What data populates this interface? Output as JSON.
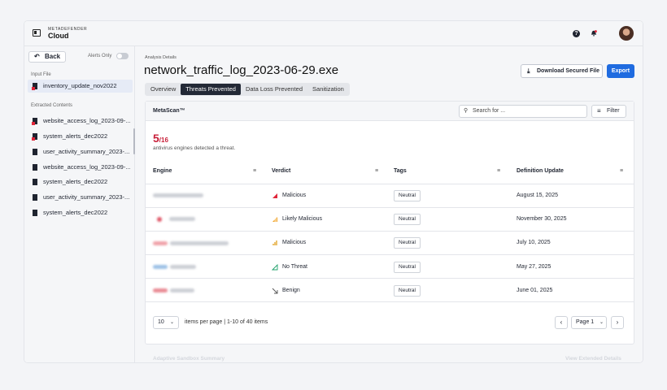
{
  "app": {
    "brand_small": "METADEFENDER",
    "brand_big": "Cloud"
  },
  "header_icons": [
    "help-icon",
    "bell-icon",
    "avatar"
  ],
  "colors": {
    "accent": "#1f6be0",
    "danger": "#c8203a",
    "active_tab": "#232936"
  },
  "sidebar": {
    "back_label": "Back",
    "alerts_only_label": "Alerts Only",
    "alerts_only_on": false,
    "input_file_label": "Input File",
    "input_file": {
      "name": "inventory_update_nov2022",
      "icon": "file-threat-icon"
    },
    "extracted_label": "Extracted Contents",
    "extracted": [
      {
        "name": "website_access_log_2023-09-...",
        "icon": "file-threat-icon"
      },
      {
        "name": "system_alerts_dec2022",
        "icon": "file-threat-icon"
      },
      {
        "name": "user_activity_summary_2023-...",
        "icon": "file-icon"
      },
      {
        "name": "website_access_log_2023-09-...",
        "icon": "file-icon"
      },
      {
        "name": "system_alerts_dec2022",
        "icon": "file-icon"
      },
      {
        "name": "user_activity_summary_2023-...",
        "icon": "file-icon"
      },
      {
        "name": "system_alerts_dec2022",
        "icon": "file-icon"
      }
    ]
  },
  "main": {
    "breadcrumb": "Analysis Details",
    "title": "network_traffic_log_2023-06-29.exe",
    "download_label": "Download Secured File",
    "export_label": "Export",
    "tabs": [
      "Overview",
      "Threats Prevented",
      "Data Loss Prevented",
      "Sanitization"
    ],
    "active_tab": "Threats Prevented"
  },
  "metascan": {
    "title": "MetaScan™",
    "search_placeholder": "Search for ...",
    "filter_label": "Filter",
    "detected": "5",
    "total": "/16",
    "detected_text": "antivirus engines detected a threat.",
    "columns": [
      "Engine",
      "Verdict",
      "Tags",
      "Definition Update"
    ],
    "rows": [
      {
        "verdict": "Malicious",
        "verdict_icon": "malicious-icon",
        "tag": "Neutral",
        "date": "August 15, 2025"
      },
      {
        "verdict": "Likely Malicious",
        "verdict_icon": "likely-malicious-icon",
        "tag": "Neutral",
        "date": "November 30, 2025"
      },
      {
        "verdict": "Malicious",
        "verdict_icon": "malicious-icon",
        "tag": "Neutral",
        "date": "July 10, 2025"
      },
      {
        "verdict": "No Threat",
        "verdict_icon": "no-threat-icon",
        "tag": "Neutral",
        "date": "May 27, 2025"
      },
      {
        "verdict": "Benign",
        "verdict_icon": "benign-icon",
        "tag": "Neutral",
        "date": "June 01, 2025"
      }
    ],
    "items_per_page": "10",
    "items_per_page_label": "items per page",
    "range_label": "1-10 of 40 items",
    "page_label": "Page 1"
  },
  "footer_ghost": {
    "left": "Adaptive Sandbox Summary",
    "right": "View Extended Details"
  }
}
